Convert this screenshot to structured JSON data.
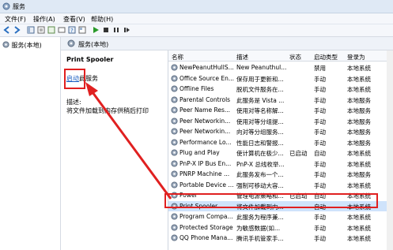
{
  "window": {
    "title": "服务"
  },
  "menu": [
    "文件(F)",
    "操作(A)",
    "查看(V)",
    "帮助(H)"
  ],
  "left_pane": {
    "tree_item": "服务(本地)"
  },
  "detail": {
    "header": "服务(本地)",
    "service_name": "Print Spooler",
    "action_link": "启动",
    "action_suffix": "此服务",
    "desc_label": "描述:",
    "desc_text": "将文件加载到内存供稍后打印"
  },
  "columns": {
    "name": "名称",
    "desc": "描述",
    "status": "状态",
    "startup": "启动类型",
    "logon": "登录为"
  },
  "rows": [
    {
      "name": "NewPeanutHullS...",
      "desc": "New Peanuthul...",
      "status": "",
      "startup": "禁用",
      "logon": "本地系统"
    },
    {
      "name": "Office Source En...",
      "desc": "保存用于更新和...",
      "status": "",
      "startup": "手动",
      "logon": "本地系统"
    },
    {
      "name": "Offline Files",
      "desc": "脱机文件服务在...",
      "status": "",
      "startup": "手动",
      "logon": "本地系统"
    },
    {
      "name": "Parental Controls",
      "desc": "此服务是 Vista ...",
      "status": "",
      "startup": "手动",
      "logon": "本地服务"
    },
    {
      "name": "Peer Name Res...",
      "desc": "使用对等名称解...",
      "status": "",
      "startup": "手动",
      "logon": "本地服务"
    },
    {
      "name": "Peer Networkin...",
      "desc": "使用对等分组提...",
      "status": "",
      "startup": "手动",
      "logon": "本地服务"
    },
    {
      "name": "Peer Networkin...",
      "desc": "向对等分组服务...",
      "status": "",
      "startup": "手动",
      "logon": "本地服务"
    },
    {
      "name": "Performance Lo...",
      "desc": "性能日志和警报...",
      "status": "",
      "startup": "手动",
      "logon": "本地服务"
    },
    {
      "name": "Plug and Play",
      "desc": "使计算机在极少...",
      "status": "已启动",
      "startup": "自动",
      "logon": "本地系统"
    },
    {
      "name": "PnP-X IP Bus En...",
      "desc": "PnP-X 总线枚举...",
      "status": "",
      "startup": "手动",
      "logon": "本地系统"
    },
    {
      "name": "PNRP Machine ...",
      "desc": "此服务发布一个...",
      "status": "",
      "startup": "手动",
      "logon": "本地服务"
    },
    {
      "name": "Portable Device ...",
      "desc": "强制可移动大容...",
      "status": "",
      "startup": "手动",
      "logon": "本地系统"
    },
    {
      "name": "Power",
      "desc": "管理电源策略和...",
      "status": "已启动",
      "startup": "自动",
      "logon": "本地系统"
    },
    {
      "name": "Print Spooler",
      "desc": "将文件加载到内...",
      "status": "",
      "startup": "自动",
      "logon": "本地系统"
    },
    {
      "name": "Program Compa...",
      "desc": "此服务为程序兼...",
      "status": "",
      "startup": "手动",
      "logon": "本地系统"
    },
    {
      "name": "Protected Storage",
      "desc": "为敏感数据(如...",
      "status": "",
      "startup": "手动",
      "logon": "本地系统"
    },
    {
      "name": "QQ Phone Mana...",
      "desc": "腾讯手机管家手...",
      "status": "",
      "startup": "手动",
      "logon": "本地系统"
    }
  ],
  "selected_row_index": 13,
  "colors": {
    "highlight": "#e02020",
    "link": "#1a5ec2",
    "selection": "#cfe3fb"
  }
}
